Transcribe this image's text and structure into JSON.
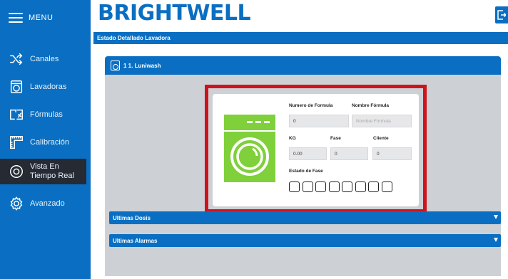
{
  "sidebar": {
    "menu_label": "MENU",
    "items": [
      {
        "label": "Canales",
        "icon": "shuffle-icon"
      },
      {
        "label": "Lavadoras",
        "icon": "washing-machine-icon"
      },
      {
        "label": "Fórmulas",
        "icon": "formula-icon"
      },
      {
        "label": "Calibración",
        "icon": "ruler-icon"
      },
      {
        "label": "Vista En Tiempo Real",
        "icon": "eye-icon"
      },
      {
        "label": "Avanzado",
        "icon": "gear-icon"
      }
    ],
    "active": "Vista En Tiempo Real"
  },
  "header": {
    "brand": "BRIGHTWELL",
    "logout_icon": "logout-icon"
  },
  "detail_bar": {
    "title": "Estado Detallado Lavadora"
  },
  "panel": {
    "title": "1 1. Luniwash",
    "form": {
      "formula_number_label": "Numero de Formula",
      "formula_number_value": "0",
      "formula_name_label": "Nombre Fórmula",
      "formula_name_placeholder": "Nombre Fórmula",
      "kg_label": "KG",
      "kg_value": "0.00",
      "fase_label": "Fase",
      "fase_value": "0",
      "cliente_label": "Cliente",
      "cliente_value": "0",
      "estado_fase_label": "Estado de Fase",
      "phase_count": 8
    }
  },
  "accordions": {
    "dosis": "Ultimas Dosis",
    "alarmas": "Ultimas Alarmas"
  },
  "colors": {
    "brand_blue": "#0a6fc2",
    "washer_green": "#7fd03a",
    "highlight_red": "#d0121b",
    "sidebar_active": "#252a33",
    "panel_bg": "#cdd1d6"
  }
}
